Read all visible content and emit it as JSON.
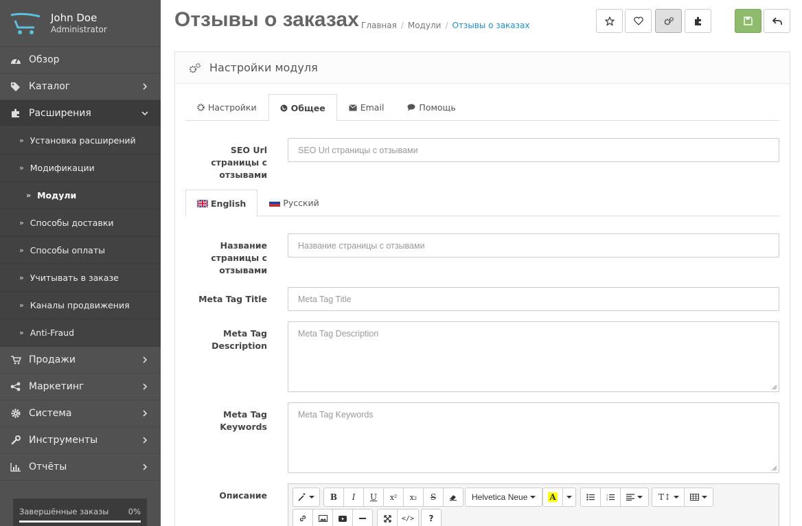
{
  "profile": {
    "name": "John Doe",
    "role": "Administrator"
  },
  "menu": {
    "overview": "Обзор",
    "catalog": "Каталог",
    "extensions": "Расширения",
    "sales": "Продажи",
    "marketing": "Маркетинг",
    "system": "Система",
    "tools": "Инструменты",
    "reports": "Отчёты"
  },
  "submenu": [
    "Установка расширений",
    "Модификации",
    "Модули",
    "Способы доставки",
    "Способы оплаты",
    "Учитывать в заказе",
    "Каналы продвижения",
    "Anti-Fraud"
  ],
  "progress": {
    "label": "Завершённые заказы",
    "value": "0%",
    "fraction": 0
  },
  "header": {
    "title": "Отзывы о заказах",
    "breadcrumb": [
      "Главная",
      "Модули",
      "Отзывы о заказах"
    ]
  },
  "panel": {
    "heading": "Настройки модуля"
  },
  "tabs": [
    "Настройки",
    "Общее",
    "Email",
    "Помощь"
  ],
  "lang_tabs": [
    "English",
    "Русский"
  ],
  "fields": {
    "seo_label": "SEO Url страницы с отзывами",
    "seo_placeholder": "SEO Url страницы с отзывами",
    "name_label": "Название страницы с отзывами",
    "name_placeholder": "Название страницы с отзывами",
    "meta_title_label": "Meta Tag Title",
    "meta_title_placeholder": "Meta Tag Title",
    "meta_desc_label": "Meta Tag Description",
    "meta_desc_placeholder": "Meta Tag Description",
    "meta_kw_label": "Meta Tag Keywords",
    "meta_kw_placeholder": "Meta Tag Keywords",
    "desc_label": "Описание"
  },
  "editor": {
    "font": "Helvetica Neue"
  },
  "colors": {
    "accent": "#1e91cf",
    "save": "#8fbb6c",
    "sidebar": "#515151"
  }
}
